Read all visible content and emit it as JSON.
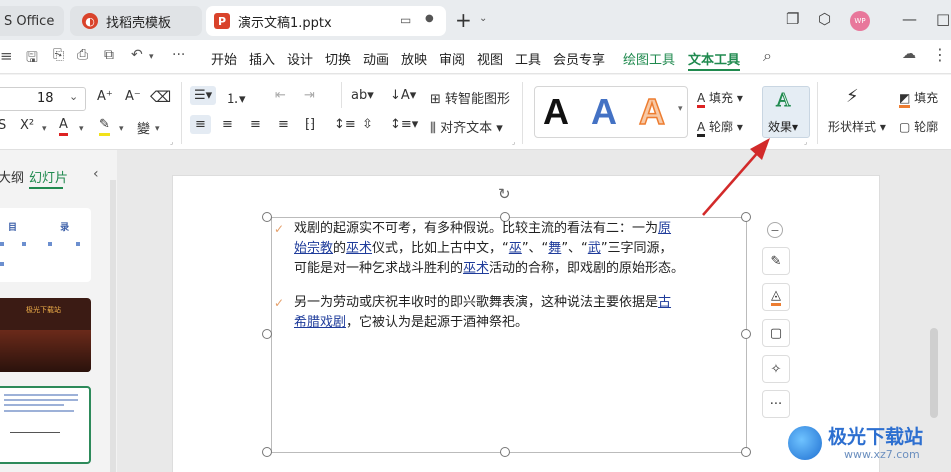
{
  "tabs": {
    "office": "S Office",
    "template": "找稻壳模板",
    "doc": "演示文稿1.pptx"
  },
  "user_initials": "WP",
  "menu": [
    "开始",
    "插入",
    "设计",
    "切换",
    "动画",
    "放映",
    "审阅",
    "视图",
    "工具",
    "会员专享",
    "绘图工具",
    "文本工具"
  ],
  "ribbon": {
    "font_size": "18",
    "smart_graphic": "转智能图形",
    "align_text": "对齐文本",
    "fill": "填充",
    "outline": "轮廓",
    "effects": "效果",
    "shape_style": "形状样式",
    "shape_fill": "填充",
    "shape_outline": "轮廓"
  },
  "panel": {
    "outline_tab": "大纲",
    "slides_tab": "幻灯片"
  },
  "thumbs": {
    "toc_title": "目 录",
    "slide2_title": "极光下载站"
  },
  "content": {
    "p1": {
      "l1a": "戏剧的起源实不可考，有多种假说。比较主流的看法有二：一为",
      "l1b": "原",
      "l2a": "始宗教",
      "l2b": "的",
      "l2c": "巫术",
      "l2d": "仪式，比如上古中文，“",
      "l2e": "巫",
      "l2f": "”、“",
      "l2g": "舞",
      "l2h": "”、“",
      "l2i": "武",
      "l2j": "”三字同源，",
      "l3a": "可能是对一种乞求战斗胜利的",
      "l3b": "巫术",
      "l3c": "活动的合称，即戏剧的原始形态。"
    },
    "p2": {
      "l1a": "另一为劳动或庆祝丰收时的即兴歌舞表演，这种说法主要依据是",
      "l1b": "古",
      "l2a": "希腊戏剧",
      "l2b": "，它被认为是起源于酒神祭祀。"
    }
  },
  "watermark": {
    "name": "极光下载站",
    "url": "www.xz7.com"
  }
}
